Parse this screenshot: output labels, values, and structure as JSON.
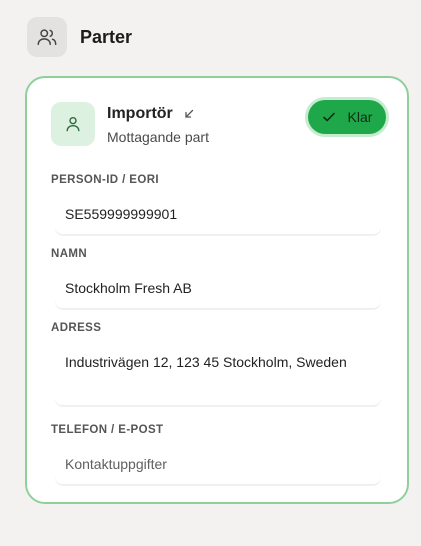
{
  "section": {
    "title": "Parter",
    "icon": "users-icon"
  },
  "party": {
    "name": "Importör",
    "subtitle": "Mottagande part",
    "icon": "user-icon",
    "collapse_icon": "arrow-down-left-icon",
    "done_button": {
      "label": "Klar",
      "icon": "check-icon"
    }
  },
  "fields": {
    "person_id": {
      "label": "PERSON-ID / EORI",
      "value": "SE559999999901"
    },
    "name": {
      "label": "NAMN",
      "value": "Stockholm Fresh AB"
    },
    "address": {
      "label": "ADRESS",
      "value": "Industrivägen 12, 123 45 Stockholm, Sweden"
    },
    "contact": {
      "label": "TELEFON / E-POST",
      "value": "",
      "placeholder": "Kontaktuppgifter"
    }
  },
  "colors": {
    "accent_green": "#1fa84a",
    "card_border": "#8fd09a",
    "icon_bg_green": "#dcf1e0",
    "page_bg": "#f3f2f0"
  }
}
